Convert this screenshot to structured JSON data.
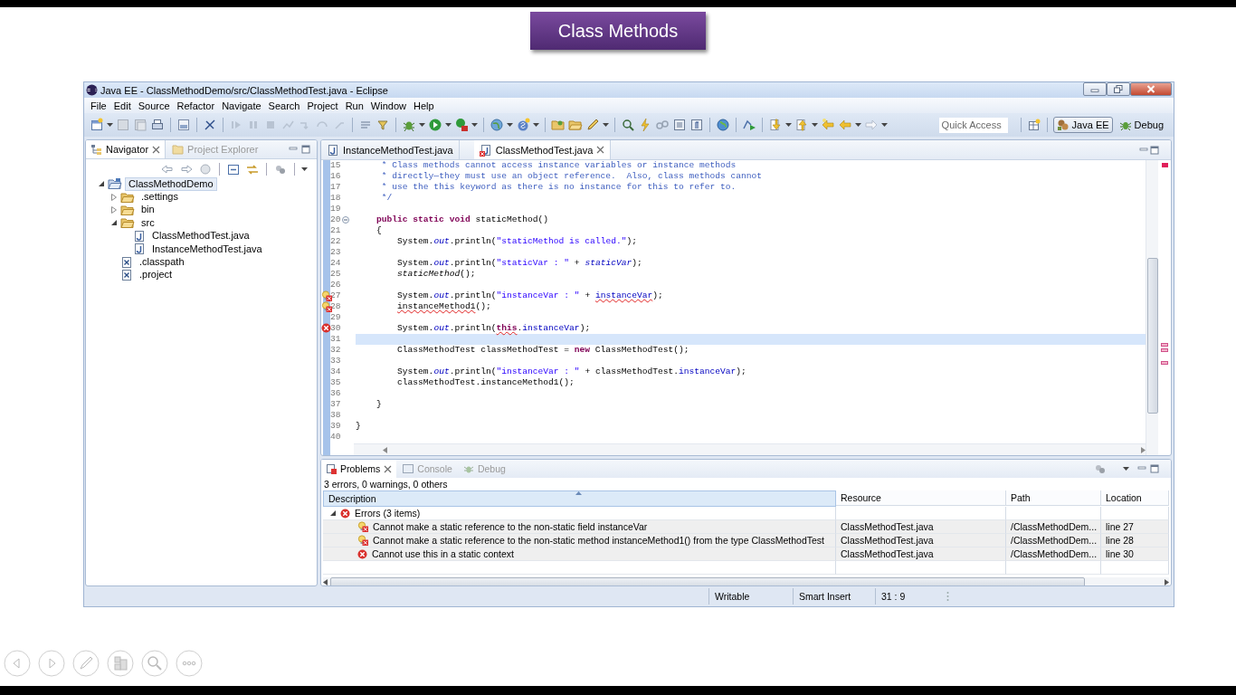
{
  "slide": {
    "title": "Class Methods"
  },
  "window": {
    "title": "Java EE - ClassMethodDemo/src/ClassMethodTest.java - Eclipse"
  },
  "menu": [
    "File",
    "Edit",
    "Source",
    "Refactor",
    "Navigate",
    "Search",
    "Project",
    "Run",
    "Window",
    "Help"
  ],
  "toolbar": {
    "quick_access": {
      "placeholder": "Quick Access"
    },
    "perspectives": [
      {
        "label": "Java EE",
        "selected": true,
        "kind": "javaee"
      },
      {
        "label": "Debug",
        "selected": false,
        "kind": "debug"
      }
    ]
  },
  "navigator": {
    "tabs": [
      {
        "label": "Navigator",
        "selected": true
      },
      {
        "label": "Project Explorer",
        "selected": false
      }
    ],
    "tree": [
      {
        "label": "ClassMethodDemo",
        "kind": "project",
        "expanded": true,
        "selected": true,
        "children": [
          {
            "label": ".settings",
            "kind": "folder",
            "expanded": false,
            "selected": false
          },
          {
            "label": "bin",
            "kind": "folder",
            "expanded": false,
            "selected": false
          },
          {
            "label": "src",
            "kind": "folder",
            "expanded": true,
            "selected": false,
            "children": [
              {
                "label": "ClassMethodTest.java",
                "kind": "java",
                "selected": false
              },
              {
                "label": "InstanceMethodTest.java",
                "kind": "java",
                "selected": false
              }
            ]
          },
          {
            "label": ".classpath",
            "kind": "xml",
            "selected": false
          },
          {
            "label": ".project",
            "kind": "xml",
            "selected": false
          }
        ]
      }
    ]
  },
  "editor": {
    "tabs": [
      {
        "label": "InstanceMethodTest.java",
        "selected": false,
        "errors": false
      },
      {
        "label": "ClassMethodTest.java",
        "selected": true,
        "errors": true
      }
    ],
    "lines": [
      {
        "num": "15",
        "current": false,
        "segments": [
          {
            "t": "     * Class methods cannot access instance variables or instance methods",
            "kind": "comment"
          }
        ]
      },
      {
        "num": "16",
        "current": false,
        "segments": [
          {
            "t": "     * directly—they must use an object reference.  Also, class methods cannot",
            "kind": "comment"
          }
        ]
      },
      {
        "num": "17",
        "current": false,
        "segments": [
          {
            "t": "     * use the this keyword as there is no instance for this to refer to.",
            "kind": "comment"
          }
        ]
      },
      {
        "num": "18",
        "current": false,
        "segments": [
          {
            "t": "     */",
            "kind": "comment"
          }
        ]
      },
      {
        "num": "19",
        "current": false
      },
      {
        "num": "20",
        "current": false,
        "kind": "fold",
        "segments": [
          {
            "t": "    public static void",
            "kind": "kw"
          },
          {
            "t": " staticMethod()",
            "kind": "plain"
          }
        ]
      },
      {
        "num": "21",
        "current": false,
        "segments": [
          {
            "t": "    {",
            "kind": "plain"
          }
        ]
      },
      {
        "num": "22",
        "current": false,
        "segments": [
          {
            "t": "        System.",
            "kind": "plain"
          },
          {
            "t": "out",
            "kind": "sfield"
          },
          {
            "t": ".println(",
            "kind": "plain"
          },
          {
            "t": "\"staticMethod is called.\"",
            "kind": "str"
          },
          {
            "t": ");",
            "kind": "plain"
          }
        ]
      },
      {
        "num": "23",
        "current": false
      },
      {
        "num": "24",
        "current": false,
        "segments": [
          {
            "t": "        System.",
            "kind": "plain"
          },
          {
            "t": "out",
            "kind": "sfield"
          },
          {
            "t": ".println(",
            "kind": "plain"
          },
          {
            "t": "\"staticVar : \"",
            "kind": "str"
          },
          {
            "t": " + ",
            "kind": "plain"
          },
          {
            "t": "staticVar",
            "kind": "sfield"
          },
          {
            "t": ");",
            "kind": "plain"
          }
        ]
      },
      {
        "num": "25",
        "current": false,
        "segments": [
          {
            "t": "        staticMethod",
            "kind": "smethod"
          },
          {
            "t": "();",
            "kind": "plain"
          }
        ]
      },
      {
        "num": "26",
        "current": false
      },
      {
        "num": "27",
        "current": false,
        "kind": "quickfix",
        "segments": [
          {
            "t": "        System.",
            "kind": "plain"
          },
          {
            "t": "out",
            "kind": "sfield"
          },
          {
            "t": ".println(",
            "kind": "plain"
          },
          {
            "t": "\"instanceVar : \"",
            "kind": "str"
          },
          {
            "t": " + ",
            "kind": "plain"
          },
          {
            "t": "instanceVar",
            "kind": "field-err"
          },
          {
            "t": ");",
            "kind": "plain"
          }
        ]
      },
      {
        "num": "28",
        "current": false,
        "kind": "quickfix",
        "segments": [
          {
            "t": "        instanceMethod1",
            "kind": "plain-err"
          },
          {
            "t": "();",
            "kind": "plain"
          }
        ]
      },
      {
        "num": "29",
        "current": false
      },
      {
        "num": "30",
        "current": false,
        "kind": "error",
        "segments": [
          {
            "t": "        System.",
            "kind": "plain"
          },
          {
            "t": "out",
            "kind": "sfield"
          },
          {
            "t": ".println(",
            "kind": "plain"
          },
          {
            "t": "this",
            "kind": "kw-err"
          },
          {
            "t": ".",
            "kind": "plain"
          },
          {
            "t": "instanceVar",
            "kind": "field"
          },
          {
            "t": ");",
            "kind": "plain"
          }
        ]
      },
      {
        "num": "31",
        "current": true
      },
      {
        "num": "32",
        "current": false,
        "segments": [
          {
            "t": "        ClassMethodTest classMethodTest = ",
            "kind": "plain"
          },
          {
            "t": "new",
            "kind": "kw"
          },
          {
            "t": " ClassMethodTest();",
            "kind": "plain"
          }
        ]
      },
      {
        "num": "33",
        "current": false
      },
      {
        "num": "34",
        "current": false,
        "segments": [
          {
            "t": "        System.",
            "kind": "plain"
          },
          {
            "t": "out",
            "kind": "sfield"
          },
          {
            "t": ".println(",
            "kind": "plain"
          },
          {
            "t": "\"instanceVar : \"",
            "kind": "str"
          },
          {
            "t": " + classMethodTest.",
            "kind": "plain"
          },
          {
            "t": "instanceVar",
            "kind": "field"
          },
          {
            "t": ");",
            "kind": "plain"
          }
        ]
      },
      {
        "num": "35",
        "current": false,
        "segments": [
          {
            "t": "        classMethodTest.instanceMethod1();",
            "kind": "plain"
          }
        ]
      },
      {
        "num": "36",
        "current": false
      },
      {
        "num": "37",
        "current": false,
        "segments": [
          {
            "t": "    }",
            "kind": "plain"
          }
        ]
      },
      {
        "num": "38",
        "current": false
      },
      {
        "num": "39",
        "current": false,
        "segments": [
          {
            "t": "}",
            "kind": "plain"
          }
        ]
      },
      {
        "num": "40",
        "current": false
      }
    ]
  },
  "problems": {
    "tabs": [
      {
        "label": "Problems",
        "selected": true,
        "kind": "problems"
      },
      {
        "label": "Console",
        "selected": false,
        "kind": "console"
      },
      {
        "label": "Debug",
        "selected": false,
        "kind": "debug"
      }
    ],
    "summary": "3 errors, 0 warnings, 0 others",
    "columns": [
      "Description",
      "Resource",
      "Path",
      "Location"
    ],
    "group": {
      "label": "Errors (3 items)",
      "expanded": true
    },
    "rows": [
      {
        "kind": "quickfix",
        "description": "Cannot make a static reference to the non-static field instanceVar",
        "resource": "ClassMethodTest.java",
        "path": "/ClassMethodDem...",
        "location": "line 27"
      },
      {
        "kind": "quickfix",
        "description": "Cannot make a static reference to the non-static method instanceMethod1() from the type ClassMethodTest",
        "resource": "ClassMethodTest.java",
        "path": "/ClassMethodDem...",
        "location": "line 28"
      },
      {
        "kind": "error",
        "description": "Cannot use this in a static context",
        "resource": "ClassMethodTest.java",
        "path": "/ClassMethodDem...",
        "location": "line 30"
      }
    ]
  },
  "status_bar": [
    "Writable",
    "Smart Insert",
    "31 : 9"
  ]
}
